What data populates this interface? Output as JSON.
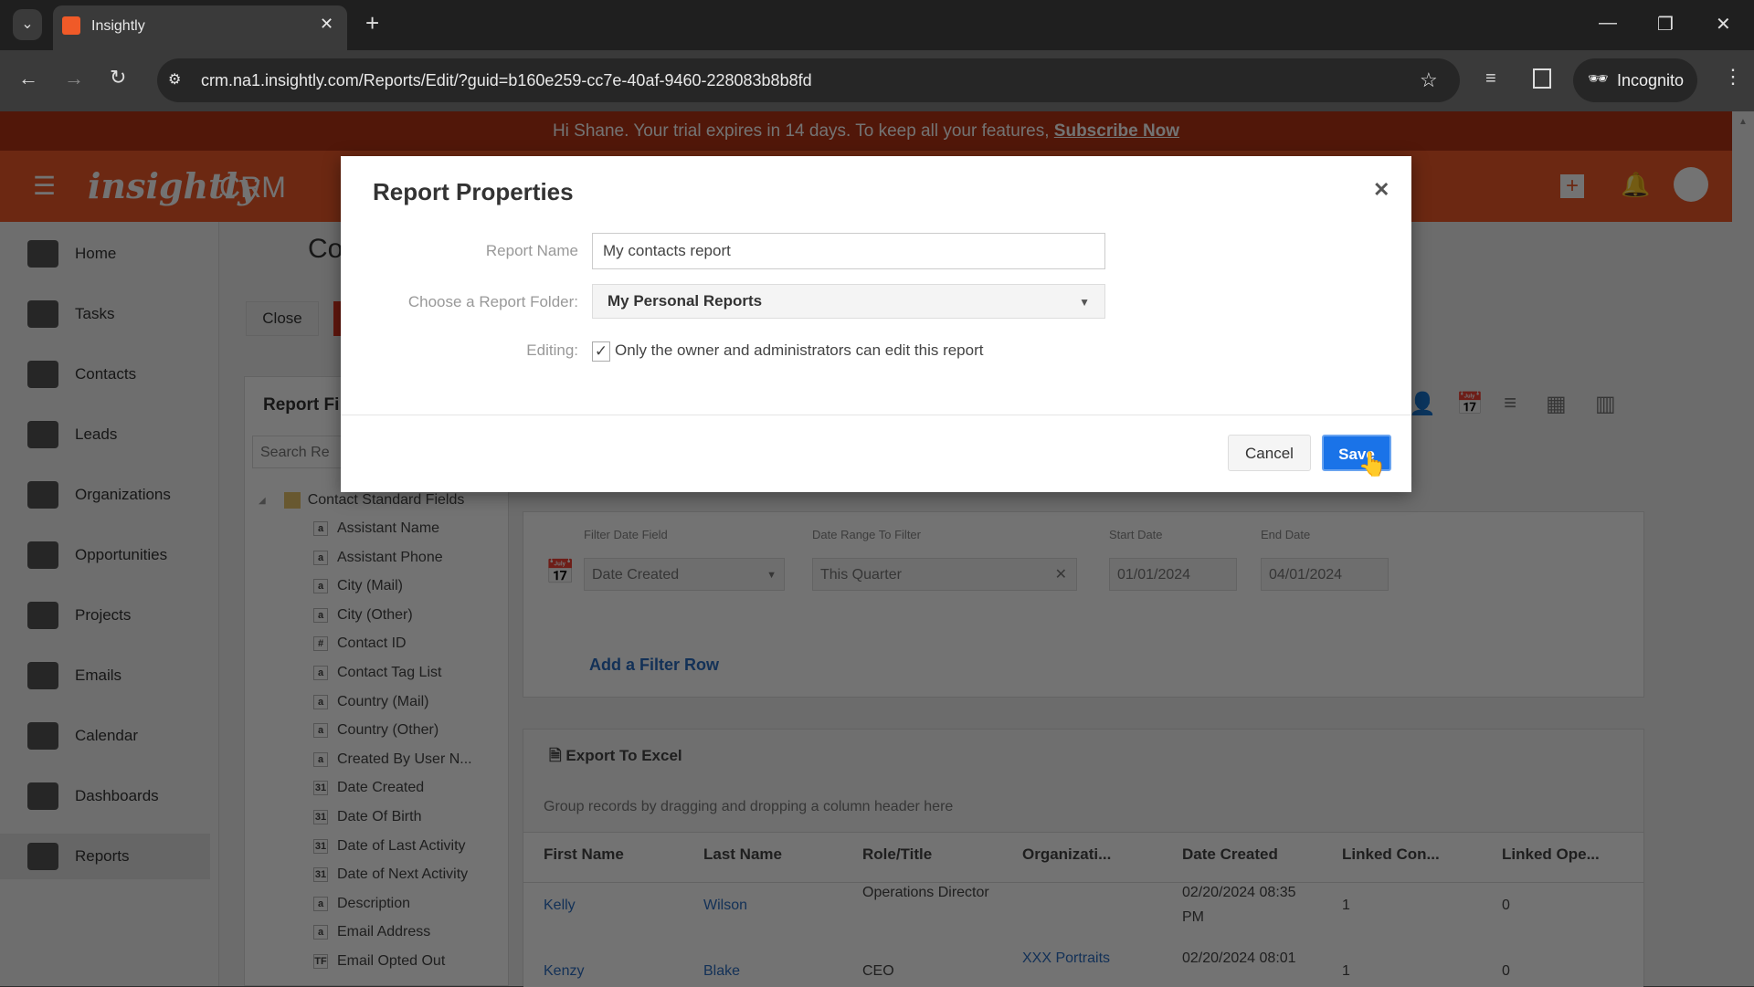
{
  "browser": {
    "tab_title": "Insightly",
    "url": "crm.na1.insightly.com/Reports/Edit/?guid=b160e259-cc7e-40af-9460-228083b8b8fd",
    "profile": "Incognito"
  },
  "banner": {
    "text": "Hi Shane. Your trial expires in 14 days. To keep all your features,",
    "link": "Subscribe Now"
  },
  "header": {
    "logo": "insightly",
    "product": "CRM"
  },
  "sidebar": {
    "items": [
      {
        "label": "Home"
      },
      {
        "label": "Tasks"
      },
      {
        "label": "Contacts"
      },
      {
        "label": "Leads"
      },
      {
        "label": "Organizations"
      },
      {
        "label": "Opportunities"
      },
      {
        "label": "Projects"
      },
      {
        "label": "Emails"
      },
      {
        "label": "Calendar"
      },
      {
        "label": "Dashboards"
      },
      {
        "label": "Reports"
      }
    ]
  },
  "page": {
    "title": "Co",
    "close": "Close",
    "fields_title": "Report Fi",
    "search_placeholder": "Search Re",
    "tree_root": "Contact Standard Fields",
    "fields": [
      {
        "t": "a",
        "label": "Assistant Name"
      },
      {
        "t": "a",
        "label": "Assistant Phone"
      },
      {
        "t": "a",
        "label": "City (Mail)"
      },
      {
        "t": "a",
        "label": "City (Other)"
      },
      {
        "t": "#",
        "label": "Contact ID"
      },
      {
        "t": "a",
        "label": "Contact Tag List"
      },
      {
        "t": "a",
        "label": "Country (Mail)"
      },
      {
        "t": "a",
        "label": "Country (Other)"
      },
      {
        "t": "a",
        "label": "Created By User N..."
      },
      {
        "t": "31",
        "label": "Date Created"
      },
      {
        "t": "31",
        "label": "Date Of Birth"
      },
      {
        "t": "31",
        "label": "Date of Last Activity"
      },
      {
        "t": "31",
        "label": "Date of Next Activity"
      },
      {
        "t": "a",
        "label": "Description"
      },
      {
        "t": "a",
        "label": "Email Address"
      },
      {
        "t": "TF",
        "label": "Email Opted Out"
      }
    ]
  },
  "filter": {
    "date_field_label": "Filter Date Field",
    "date_field": "Date Created",
    "range_label": "Date Range To Filter",
    "range": "This Quarter",
    "start_label": "Start Date",
    "start": "01/01/2024",
    "end_label": "End Date",
    "end": "04/01/2024",
    "add_row": "Add a Filter Row"
  },
  "grid": {
    "export": "Export To Excel",
    "group_hint": "Group records by dragging and dropping a column header here",
    "columns": [
      "First Name",
      "Last Name",
      "Role/Title",
      "Organizati...",
      "Date Created",
      "Linked Con...",
      "Linked Ope..."
    ],
    "rows": [
      [
        "Kelly",
        "Wilson",
        "Operations Director",
        "",
        "02/20/2024 08:35 PM",
        "1",
        "0"
      ],
      [
        "Kenzy",
        "Blake",
        "CEO",
        "XXX Portraits",
        "02/20/2024 08:01",
        "1",
        "0"
      ]
    ]
  },
  "modal": {
    "title": "Report Properties",
    "name_label": "Report Name",
    "name_value": "My contacts report",
    "folder_label": "Choose a Report Folder:",
    "folder_value": "My Personal Reports",
    "editing_label": "Editing:",
    "editing_checked": true,
    "editing_text": "Only the owner and administrators can edit this report",
    "cancel": "Cancel",
    "save": "Save"
  },
  "colors": {
    "brand": "#f05a28",
    "save": "#1a73e8"
  }
}
